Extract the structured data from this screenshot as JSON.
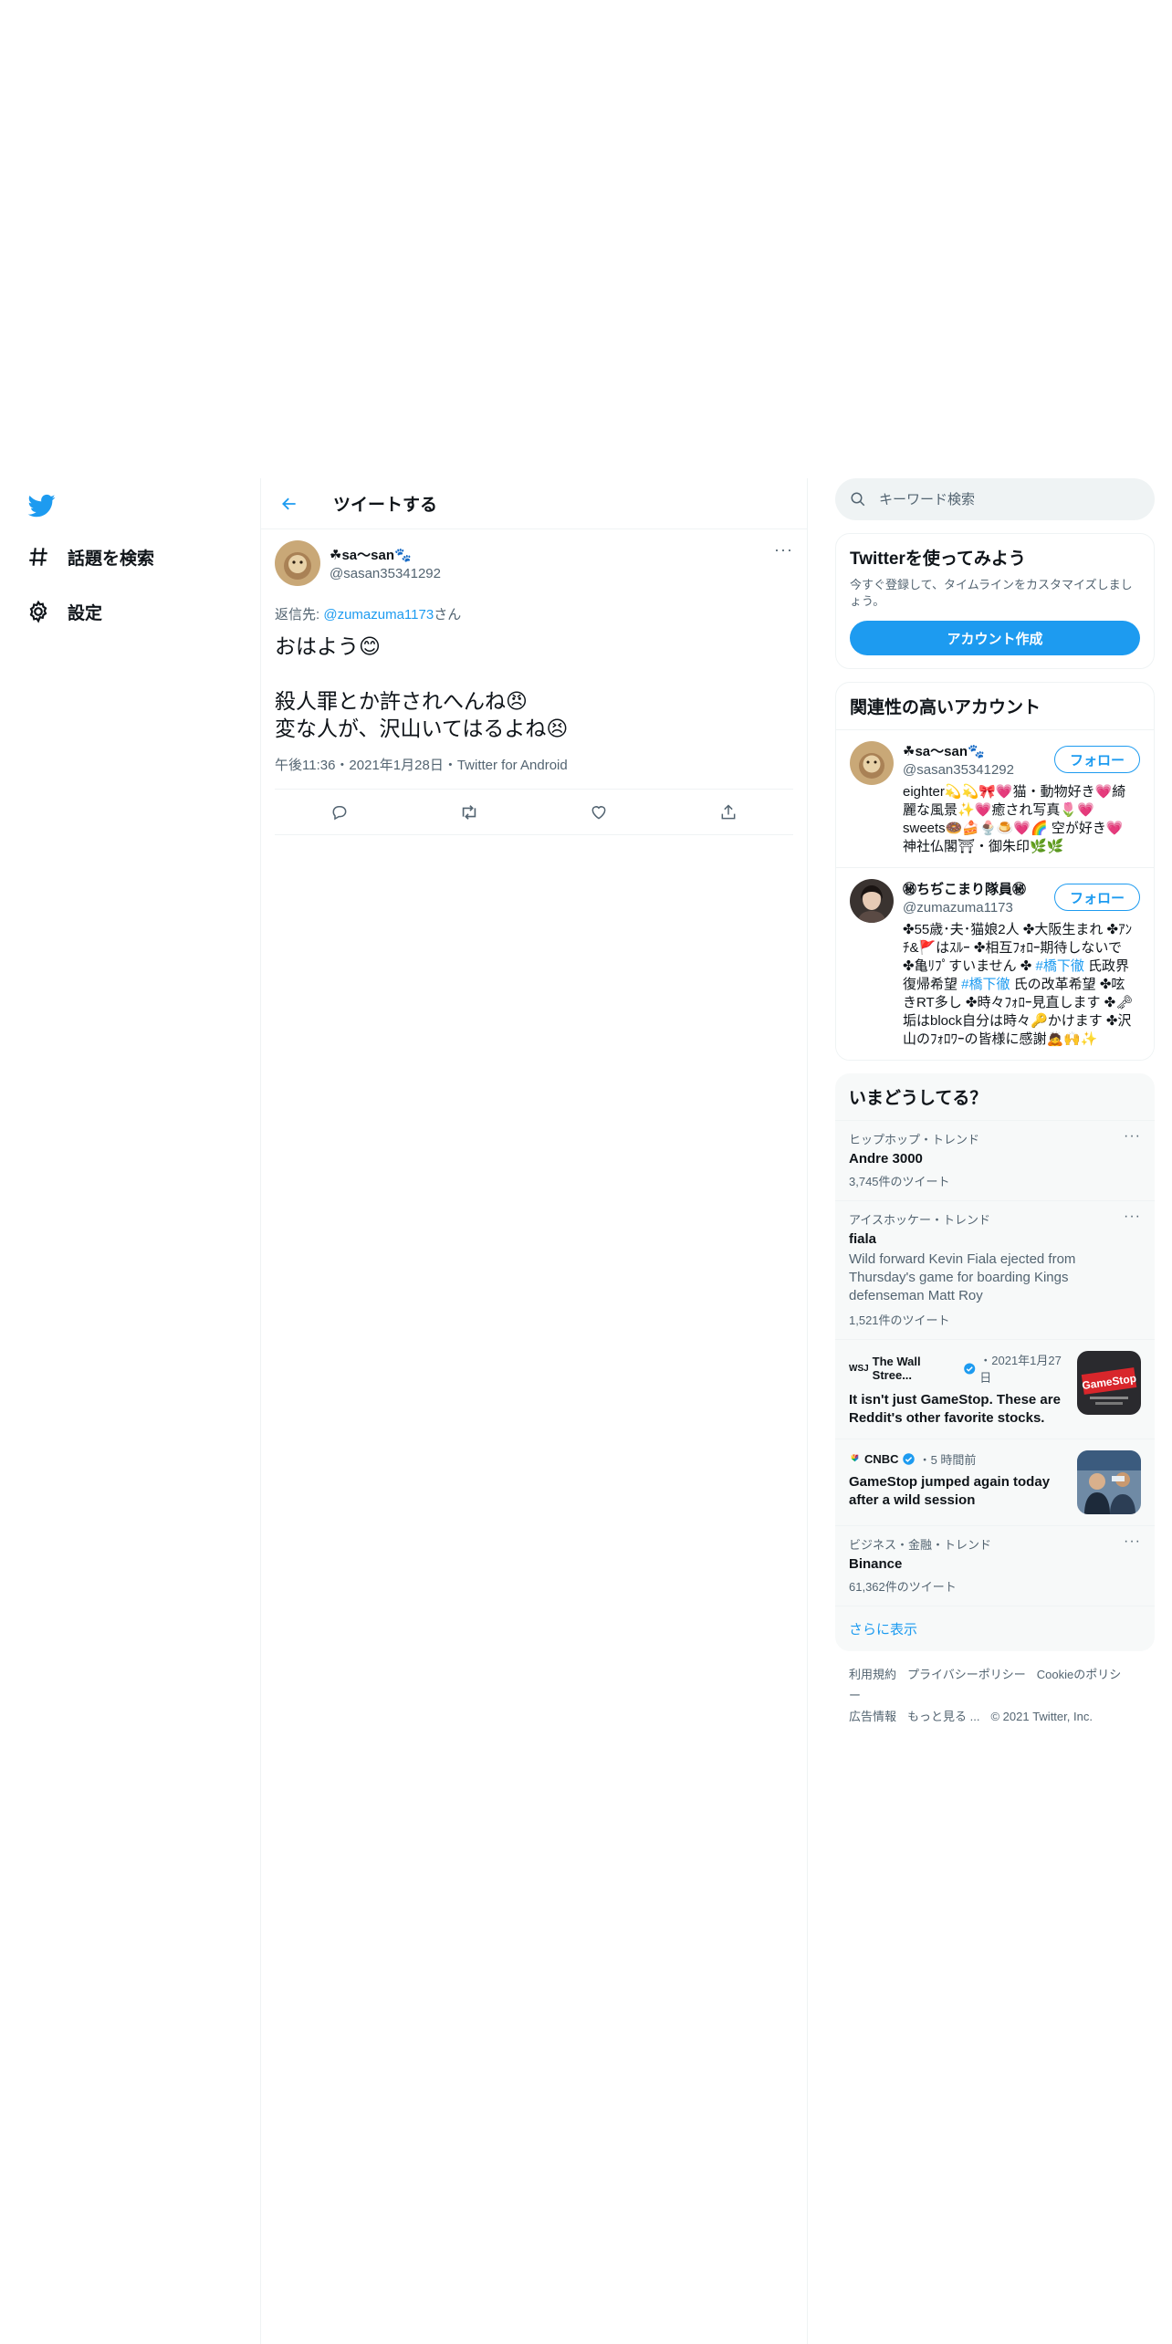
{
  "nav": {
    "explore_label": "話題を検索",
    "settings_label": "設定"
  },
  "header": {
    "title": "ツイートする"
  },
  "tweet": {
    "name": "☘sa〜san🐾",
    "handle": "@sasan35341292",
    "reply_prefix": "返信先: ",
    "reply_handle": "@zumazuma1173",
    "reply_suffix": "さん",
    "line1": "おはよう😊",
    "line2": "殺人罪とか許されへんね😠",
    "line3": "変な人が、沢山いてはるよね😣",
    "meta": "午後11:36・2021年1月28日・Twitter for Android"
  },
  "search": {
    "placeholder": "キーワード検索"
  },
  "signup": {
    "title": "Twitterを使ってみよう",
    "subtitle": "今すぐ登録して、タイムラインをカスタマイズしましょう。",
    "button": "アカウント作成"
  },
  "relevant": {
    "title": "関連性の高いアカウント",
    "accounts": [
      {
        "name": "☘sa〜san🐾",
        "handle": "@sasan35341292",
        "follow": "フォロー",
        "bio": "eighter💫💫🎀💗猫・動物好き💗綺麗な風景✨💗癒され写真🌷💗sweets🍩🍰🍨🍮💗🌈 空が好き💗神社仏閣⛩・御朱印🌿🌿"
      },
      {
        "name": "㊙ちぢこまり隊員㊙",
        "handle": "@zumazuma1173",
        "follow": "フォロー",
        "bio_a": "✤55歳･夫･猫娘2人 ✤大阪生まれ ✤ｱﾝﾁ&🚩はｽﾙｰ ✤相互ﾌｫﾛｰ期待しないで ✤亀ﾘﾌﾟすいません ✤ ",
        "hashtag1": "#橋下徹",
        "bio_b": " 氏政界復帰希望 ",
        "hashtag2": "#橋下徹",
        "bio_c": " 氏の改革希望 ✤呟きRT多し ✤時々ﾌｫﾛｰ見直します ✤🗝垢はblock自分は時々🔑かけます ✤沢山のﾌｫﾛﾜｰの皆様に感謝🙇🙌✨"
      }
    ]
  },
  "trends": {
    "title": "いまどうしてる？",
    "items": [
      {
        "context": "ヒップホップ・トレンド",
        "title": "Andre 3000",
        "count": "3,745件のツイート"
      },
      {
        "context": "アイスホッケー・トレンド",
        "title": "fiala",
        "desc": "Wild forward Kevin Fiala ejected from Thursday's game for boarding Kings defenseman Matt Roy",
        "count": "1,521件のツイート"
      },
      {
        "context": "ビジネス・金融・トレンド",
        "title": "Binance",
        "count": "61,362件のツイート"
      }
    ],
    "news": [
      {
        "source": "The Wall Stree...",
        "time": "・2021年1月27日",
        "title": "It isn't just GameStop. These are Reddit's other favorite stocks.",
        "image_text": "GameStop"
      },
      {
        "source": "CNBC",
        "time": "・5 時間前",
        "title": "GameStop jumped again today after a wild session"
      }
    ],
    "show_more": "さらに表示"
  },
  "footer": {
    "links": [
      "利用規約",
      "プライバシーポリシー",
      "Cookieのポリシー",
      "広告情報",
      "もっと見る ..."
    ],
    "copyright": "© 2021 Twitter, Inc."
  },
  "colors": {
    "accent": "#1d9bf0",
    "text": "#0f1419",
    "secondary": "#536471",
    "border": "#eff3f4"
  }
}
